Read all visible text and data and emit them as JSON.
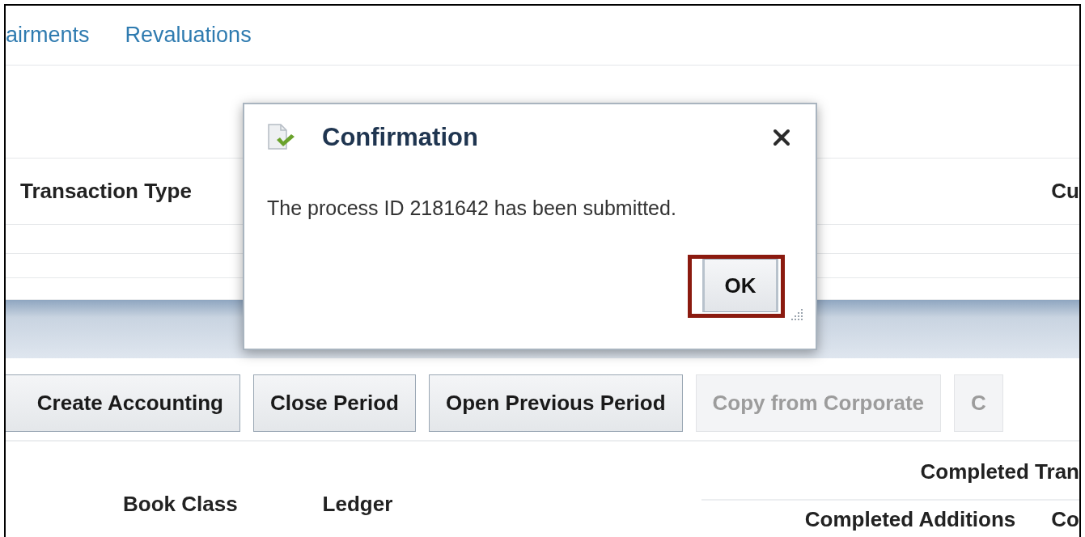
{
  "tabs": [
    {
      "label": "airments"
    },
    {
      "label": "Revaluations"
    }
  ],
  "table": {
    "columns": [
      "Transaction Type",
      "Cu"
    ]
  },
  "buttons": [
    {
      "label": "Create Accounting",
      "disabled": false
    },
    {
      "label": "Close Period",
      "disabled": false
    },
    {
      "label": "Open Previous Period",
      "disabled": false
    },
    {
      "label": "Copy from Corporate",
      "disabled": true
    },
    {
      "label": "C",
      "disabled": true
    }
  ],
  "summary": {
    "heading": "Completed Tran",
    "left_columns": [
      "Book Class",
      "Ledger"
    ],
    "right_columns": [
      "Completed Additions",
      "Co"
    ]
  },
  "dialog": {
    "title": "Confirmation",
    "message": "The process ID 2181642 has been submitted.",
    "ok_button": {
      "label": "OK",
      "highlighted": true
    }
  }
}
